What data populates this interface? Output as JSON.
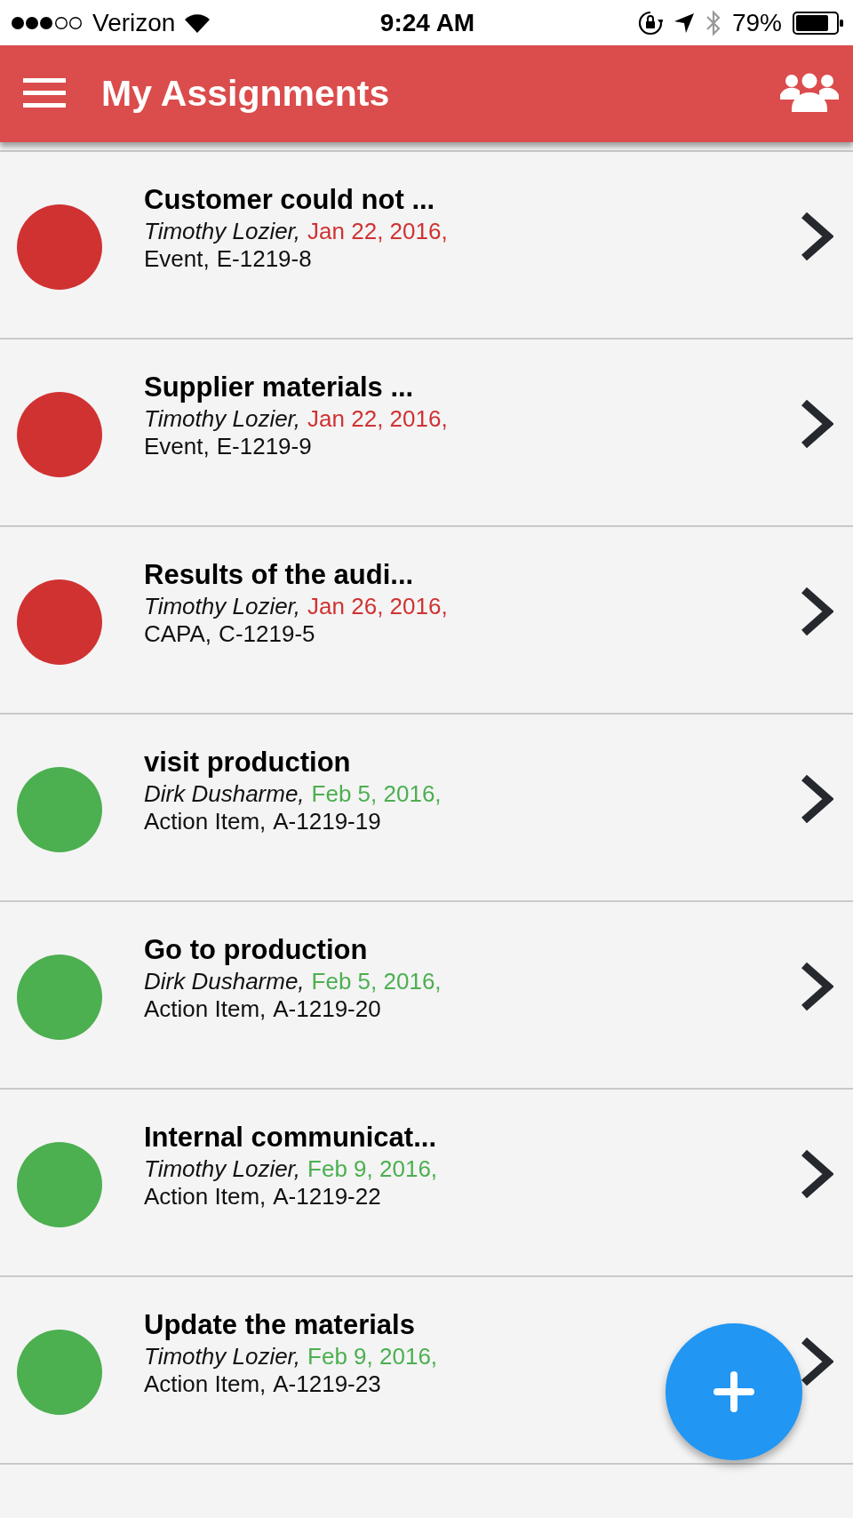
{
  "status_bar": {
    "carrier": "Verizon",
    "time": "9:24 AM",
    "battery": "79%"
  },
  "header": {
    "title": "My Assignments"
  },
  "assignments": [
    {
      "title": "Customer could not ...",
      "person": "Timothy Lozier,",
      "date": "Jan 22, 2016,",
      "type": "Event,",
      "number": "E-1219-8",
      "color": "#d03232"
    },
    {
      "title": "Supplier materials ...",
      "person": "Timothy Lozier,",
      "date": "Jan 22, 2016,",
      "type": "Event,",
      "number": "E-1219-9",
      "color": "#d03232"
    },
    {
      "title": "Results of the audi...",
      "person": "Timothy Lozier,",
      "date": "Jan 26, 2016,",
      "type": "CAPA,",
      "number": "C-1219-5",
      "color": "#d03232"
    },
    {
      "title": "visit production",
      "person": "Dirk Dusharme,",
      "date": "Feb 5, 2016,",
      "type": "Action Item,",
      "number": "A-1219-19",
      "color": "#4caf50"
    },
    {
      "title": "Go to production",
      "person": "Dirk Dusharme,",
      "date": "Feb 5, 2016,",
      "type": "Action Item,",
      "number": "A-1219-20",
      "color": "#4caf50"
    },
    {
      "title": "Internal communicat...",
      "person": "Timothy Lozier,",
      "date": "Feb 9, 2016,",
      "type": "Action Item,",
      "number": "A-1219-22",
      "color": "#4caf50"
    },
    {
      "title": "Update the materials",
      "person": "Timothy Lozier,",
      "date": "Feb 9, 2016,",
      "type": "Action Item,",
      "number": "A-1219-23",
      "color": "#4caf50"
    }
  ]
}
